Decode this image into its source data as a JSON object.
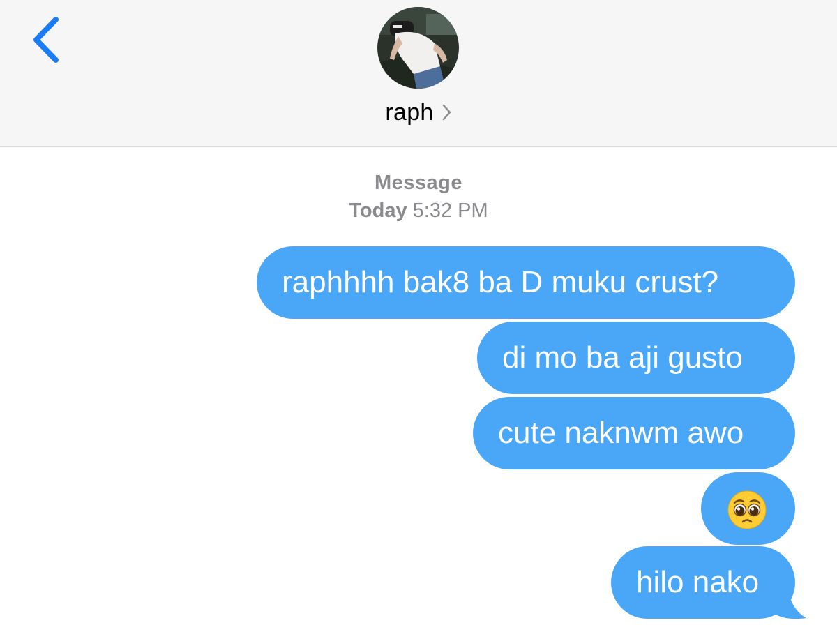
{
  "header": {
    "back_icon": "chevron-left-icon",
    "contact_name": "raph",
    "details_icon": "chevron-right-icon"
  },
  "thread": {
    "service": "Message",
    "timestamp_day": "Today",
    "timestamp_time": "5:32 PM"
  },
  "messages": [
    {
      "text": "raphhhh bak8 ba D muku crust?",
      "direction": "sent"
    },
    {
      "text": "di mo ba aji gusto",
      "direction": "sent"
    },
    {
      "text": "cute naknwm awo",
      "direction": "sent"
    },
    {
      "text": "",
      "emoji": "pleading-face-emoji",
      "direction": "sent"
    },
    {
      "text": "hilo nako",
      "direction": "sent"
    }
  ],
  "colors": {
    "sent_bubble": "#4aa7f8",
    "header_bg": "#f6f6f6",
    "back_icon": "#1a7cf6",
    "meta_text": "#8a8a8e"
  }
}
